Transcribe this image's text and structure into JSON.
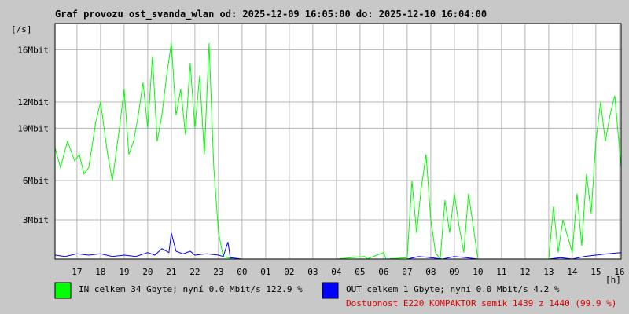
{
  "chart_data": {
    "type": "line",
    "title": "Graf provozu ost_svanda_wlan od: 2025-12-09 16:05:00 do: 2025-12-10 16:04:00",
    "ylabel": "[/s]",
    "xlabel": "[h]",
    "grid": true,
    "x_ticks": [
      "17",
      "18",
      "19",
      "20",
      "21",
      "22",
      "23",
      "00",
      "01",
      "02",
      "03",
      "04",
      "05",
      "06",
      "07",
      "08",
      "09",
      "10",
      "11",
      "12",
      "13",
      "14",
      "15",
      "16"
    ],
    "y_ticks": [
      {
        "label": "3Mbit",
        "value": 3
      },
      {
        "label": "6Mbit",
        "value": 6
      },
      {
        "label": "10Mbit",
        "value": 10
      },
      {
        "label": "12Mbit",
        "value": 12
      },
      {
        "label": "16Mbit",
        "value": 16
      }
    ],
    "ylim": [
      0,
      18
    ],
    "xlim": [
      16.07,
      40.07
    ],
    "series": [
      {
        "name": "IN",
        "color": "#00ff00",
        "x": [
          16.07,
          16.3,
          16.6,
          16.9,
          17.1,
          17.3,
          17.5,
          17.8,
          18.0,
          18.3,
          18.5,
          18.8,
          19.0,
          19.2,
          19.4,
          19.6,
          19.8,
          20.0,
          20.2,
          20.4,
          20.6,
          20.8,
          21.0,
          21.2,
          21.4,
          21.6,
          21.8,
          22.0,
          22.2,
          22.4,
          22.6,
          22.8,
          23.0,
          23.2,
          23.4,
          23.6,
          24.0,
          28.0,
          29.2,
          29.3,
          30.0,
          30.1,
          31.0,
          31.2,
          31.4,
          31.6,
          31.8,
          32.0,
          32.2,
          32.4,
          32.6,
          32.8,
          33.0,
          33.2,
          33.4,
          33.6,
          34.0,
          35.0,
          36.0,
          37.0,
          37.2,
          37.4,
          37.6,
          38.0,
          38.2,
          38.4,
          38.6,
          38.8,
          39.0,
          39.2,
          39.4,
          39.6,
          39.8,
          40.07
        ],
        "values": [
          8.5,
          7.0,
          9.0,
          7.5,
          8.0,
          6.5,
          7.0,
          10.5,
          12.0,
          8.0,
          6.0,
          10.0,
          13.0,
          8.0,
          9.0,
          11.0,
          13.5,
          10.0,
          15.5,
          9.0,
          11.0,
          14.0,
          16.5,
          11.0,
          13.0,
          9.5,
          15.0,
          10.0,
          14.0,
          8.0,
          16.5,
          7.0,
          2.0,
          0.2,
          0.1,
          0.0,
          0.0,
          0.0,
          0.2,
          0.0,
          0.5,
          0.0,
          0.1,
          6.0,
          2.0,
          5.5,
          8.0,
          3.0,
          0.5,
          0.0,
          4.5,
          2.0,
          5.0,
          2.5,
          0.5,
          5.0,
          0.0,
          0.0,
          0.0,
          0.0,
          4.0,
          0.5,
          3.0,
          0.5,
          5.0,
          1.0,
          6.5,
          3.5,
          9.0,
          12.0,
          9.0,
          11.0,
          12.5,
          7.0
        ]
      },
      {
        "name": "OUT",
        "color": "#0000ff",
        "x": [
          16.07,
          16.5,
          17.0,
          17.5,
          18.0,
          18.5,
          19.0,
          19.5,
          20.0,
          20.3,
          20.6,
          20.9,
          21.0,
          21.2,
          21.5,
          21.8,
          22.0,
          22.5,
          23.0,
          23.2,
          23.4,
          23.5,
          24.0,
          28.0,
          31.0,
          31.5,
          32.0,
          32.5,
          33.0,
          33.5,
          34.0,
          36.0,
          37.0,
          37.5,
          38.0,
          38.5,
          39.0,
          39.5,
          40.07
        ],
        "values": [
          0.3,
          0.2,
          0.4,
          0.3,
          0.4,
          0.2,
          0.3,
          0.2,
          0.5,
          0.3,
          0.8,
          0.5,
          2.0,
          0.6,
          0.4,
          0.6,
          0.3,
          0.4,
          0.3,
          0.2,
          1.3,
          0.1,
          0.0,
          0.0,
          0.0,
          0.2,
          0.1,
          0.0,
          0.2,
          0.1,
          0.0,
          0.0,
          0.0,
          0.1,
          0.0,
          0.2,
          0.3,
          0.4,
          0.5
        ]
      }
    ],
    "legend": [
      {
        "color": "#00ff00",
        "text": "IN celkem 34 Gbyte; nyní   0.0 Mbit/s 122.9 %"
      },
      {
        "color": "#0000ff",
        "text": "OUT celkem 1 Gbyte; nyní   0.0 Mbit/s 4.2 %"
      }
    ],
    "availability": "Dostupnost E220 KOMPAKTOR semik 1439 z 1440 (99.9 %)",
    "availability_color": "#e00000"
  }
}
